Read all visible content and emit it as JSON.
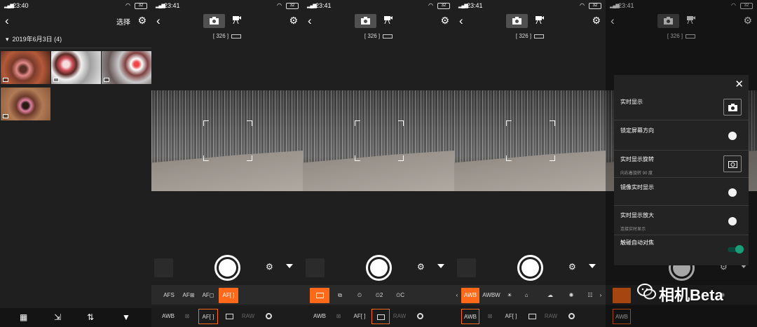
{
  "colors": {
    "accent": "#ff6a1a",
    "toggle_on": "#1a9e7a",
    "background": "#1f1f1f"
  },
  "panel1": {
    "time": "23:40",
    "battery": "32",
    "select_label": "选择",
    "date_header": "2019年6月3日 (4)",
    "nav_icons": [
      "grid-icon",
      "share-icon",
      "sort-icon",
      "filter-icon"
    ]
  },
  "camera_common": {
    "time": "23:41",
    "battery": "32",
    "shots_remaining": "[ 326 ]"
  },
  "panel2": {
    "row1": [
      "AFS",
      "AF⊞",
      "AF◻",
      "AF[ ]"
    ],
    "row1_selected": "AF[ ]",
    "row2": [
      "AWB",
      "",
      "AF[ ]",
      "",
      "RAW",
      ""
    ]
  },
  "panel3": {
    "row1": [
      "",
      "",
      "",
      "2",
      "C"
    ],
    "row2": [
      "AWB",
      "",
      "AF[ ]",
      "",
      "RAW",
      ""
    ]
  },
  "panel4": {
    "row1": [
      "AWB",
      "AWBW",
      "",
      "",
      "",
      "",
      ""
    ],
    "row2": [
      "AWB",
      "",
      "AF[ ]",
      "",
      "RAW",
      ""
    ]
  },
  "panel5": {
    "settings": [
      {
        "label": "实时显示",
        "sub": "",
        "control": "camera-icon"
      },
      {
        "label": "锁定屏幕方向",
        "sub": "",
        "control": "toggle-off"
      },
      {
        "label": "实时显示旋转",
        "sub": "向右着旋转 90 度",
        "control": "rotate-icon"
      },
      {
        "label": "镜像实时显示",
        "sub": "",
        "control": "toggle-off"
      },
      {
        "label": "实时显示放大",
        "sub": "连接实时显示",
        "control": "toggle-off"
      },
      {
        "label": "触碰自动对焦",
        "sub": "",
        "control": "toggle-on"
      }
    ]
  },
  "watermark": {
    "text": "相机Beta"
  }
}
